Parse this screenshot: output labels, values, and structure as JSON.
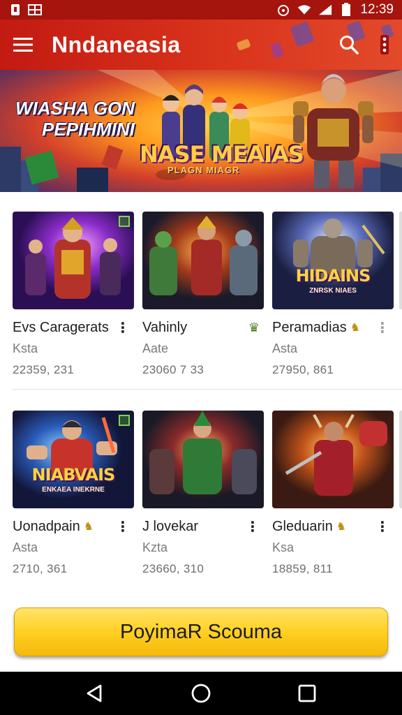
{
  "status_bar": {
    "time": "12:39",
    "icons": [
      "notification-icon",
      "gallery-icon",
      "alarm-icon",
      "wifi-icon",
      "signal-icon",
      "battery-icon"
    ]
  },
  "app_bar": {
    "title": "Nndaneasia",
    "icons": [
      "menu-icon",
      "search-icon",
      "more-vert-icon"
    ],
    "color": "#c9201a"
  },
  "banner": {
    "title_line1": "WIASHA GON",
    "title_line2": "PEPIHMINI",
    "logo_main": "NASE MEAIAS",
    "logo_sub": "PLAGN MIAGR"
  },
  "games": {
    "row1": [
      {
        "name": "Evs Caragerats",
        "subtitle": "Ksta",
        "count": "22359, 231",
        "badge": ""
      },
      {
        "name": "Vahinly",
        "subtitle": "Aate",
        "count": "23060 7 33",
        "badge": ""
      },
      {
        "name": "Peramadias",
        "subtitle": "Asta",
        "count": "27950, 861",
        "badge": "HIDAINS",
        "badge_sub": "ZNRSK NIAES"
      }
    ],
    "row2": [
      {
        "name": "Uonadpain",
        "subtitle": "Asta",
        "count": "2710, 361",
        "badge": "NIABVAIS",
        "badge_sub": "ENKAEA INEKRNE"
      },
      {
        "name": "J lovekar",
        "subtitle": "Kzta",
        "count": "23660, 310",
        "badge": ""
      },
      {
        "name": "Gleduarin",
        "subtitle": "Ksa",
        "count": "18859, 811",
        "badge": ""
      }
    ]
  },
  "cta": {
    "label": "PoyimaR Scouma",
    "color": "#ffd022"
  },
  "nav_bar": {
    "icons": [
      "back-icon",
      "home-icon",
      "recents-icon"
    ]
  }
}
